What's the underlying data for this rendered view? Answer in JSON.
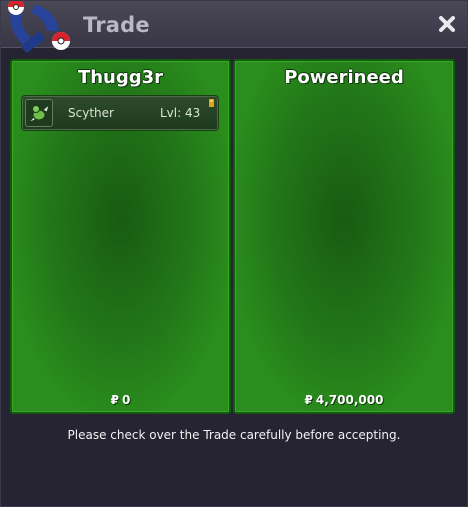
{
  "window": {
    "title": "Trade",
    "icons": {
      "logo": "pokeball-logo-icon",
      "close": "close-icon"
    }
  },
  "left_panel": {
    "player_name": "Thugg3r",
    "currency_symbol": "₽",
    "money": "0",
    "pokemon": [
      {
        "name": "Scyther",
        "level": "Lvl: 43",
        "icon": "scyther-icon",
        "held_item_icon": "held-item-icon"
      }
    ]
  },
  "right_panel": {
    "player_name": "Powerineed",
    "currency_symbol": "₽",
    "money": "4,700,000",
    "pokemon": []
  },
  "footer": {
    "notice": "Please check over the Trade carefully before accepting."
  },
  "colors": {
    "panel_green": "#2a8d1d",
    "panel_border": "#0f5c0f",
    "window_bg": "#262433",
    "titlebar": "#4a4857",
    "title_text": "#b9b8c3"
  }
}
